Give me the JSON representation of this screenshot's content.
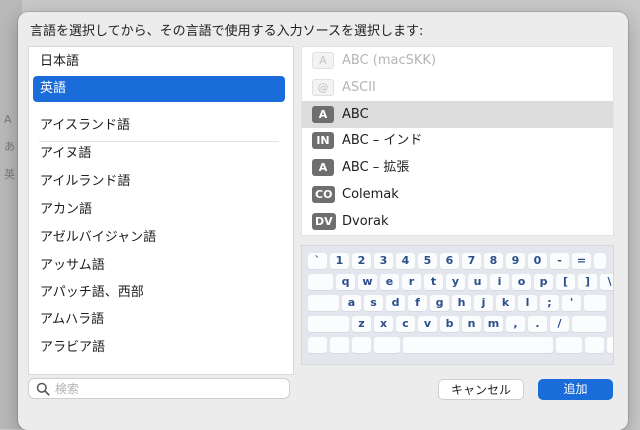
{
  "background": {
    "peek_text": [
      "A",
      "あ",
      "英"
    ]
  },
  "dialog": {
    "prompt": "言語を選択してから、その言語で使用する入力ソースを選択します:",
    "languages": [
      {
        "label": "日本語",
        "selected": false
      },
      {
        "label": "英語",
        "selected": true
      },
      {
        "label": "アイスランド語",
        "selected": false
      },
      {
        "label": "アイヌ語",
        "selected": false
      },
      {
        "label": "アイルランド語",
        "selected": false
      },
      {
        "label": "アカン語",
        "selected": false
      },
      {
        "label": "アゼルバイジャン語",
        "selected": false
      },
      {
        "label": "アッサム語",
        "selected": false
      },
      {
        "label": "アパッチ語、西部",
        "selected": false
      },
      {
        "label": "アムハラ語",
        "selected": false
      },
      {
        "label": "アラビア語",
        "selected": false
      }
    ],
    "sources": [
      {
        "badge": "A",
        "label": "ABC (macSKK)",
        "disabled": true,
        "selected": false
      },
      {
        "badge": "@",
        "label": "ASCII",
        "disabled": true,
        "selected": false
      },
      {
        "badge": "A",
        "label": "ABC",
        "disabled": false,
        "selected": true
      },
      {
        "badge": "IN",
        "label": "ABC – インド",
        "disabled": false,
        "selected": false
      },
      {
        "badge": "A",
        "label": "ABC – 拡張",
        "disabled": false,
        "selected": false
      },
      {
        "badge": "CO",
        "label": "Colemak",
        "disabled": false,
        "selected": false
      },
      {
        "badge": "DV",
        "label": "Dvorak",
        "disabled": false,
        "selected": false
      }
    ],
    "keyboard_rows": [
      [
        "`",
        "1",
        "2",
        "3",
        "4",
        "5",
        "6",
        "7",
        "8",
        "9",
        "0",
        "-",
        "="
      ],
      [
        "q",
        "w",
        "e",
        "r",
        "t",
        "y",
        "u",
        "i",
        "o",
        "p",
        "[",
        "]",
        "\\"
      ],
      [
        "a",
        "s",
        "d",
        "f",
        "g",
        "h",
        "j",
        "k",
        "l",
        ";",
        "'"
      ],
      [
        "z",
        "x",
        "c",
        "v",
        "b",
        "n",
        "m",
        ",",
        ".",
        "/"
      ]
    ],
    "search": {
      "placeholder": "検索",
      "value": ""
    },
    "buttons": {
      "cancel": "キャンセル",
      "add": "追加"
    },
    "colors": {
      "accent": "#1a6cdb",
      "key_text": "#2b4f8a"
    }
  }
}
